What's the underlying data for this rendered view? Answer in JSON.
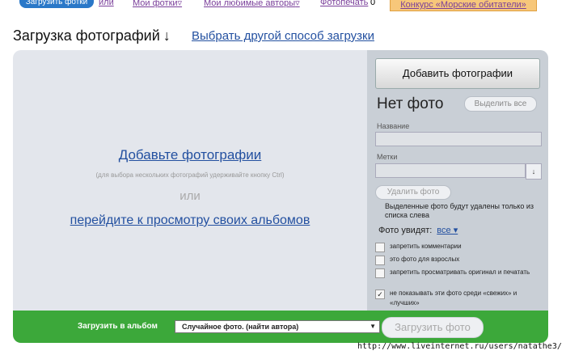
{
  "topnav": {
    "upload_tab": "Загрузить фотки",
    "or": "или",
    "my_photos": "Мои фотки",
    "favorite_authors": "Мои любимые авторы",
    "photo_print": "Фотопечать",
    "photo_print_count": "0",
    "contest": "Конкурс «Морские обитатели»",
    "dropdown_glyph": "▿"
  },
  "header": {
    "title": "Загрузка фотографий",
    "title_arrow": "↓",
    "alt_method_link": "Выбрать другой способ загрузки"
  },
  "dropzone": {
    "add_link": "Добавьте фотографии",
    "hint": "(для выбора нескольких фотографий удерживайте кнопку Ctrl)",
    "or": "или",
    "albums_link": "перейдите к просмотру своих альбомов"
  },
  "sidebar": {
    "add_button": "Добавить фотографии",
    "no_photo": "Нет фото",
    "select_all": "Выделить все",
    "name_label": "Название",
    "name_value": "",
    "tags_label": "Метки",
    "tags_value": "",
    "tags_dropdown_glyph": "↓",
    "delete_button": "Удалить фото",
    "delete_note": "Выделенные фото будут удалены только из списка слева",
    "visibility_label": "Фото увидят:",
    "visibility_value": "все ▾",
    "options": [
      {
        "label": "запретить комментарии",
        "checked": false
      },
      {
        "label": "это фото для взрослых",
        "checked": false
      },
      {
        "label": "запретить просматривать оригинал и печатать",
        "checked": false
      },
      {
        "label": "не показывать эти фото среди «свежих» и «лучших»",
        "checked": true
      }
    ],
    "check_glyph": "✓"
  },
  "bottom_bar": {
    "album_label": "Загрузить в альбом",
    "album_select": "Случайное фото. (найти автора)",
    "select_caret": "▼",
    "upload_button": "Загрузить фото"
  },
  "footer": {
    "url": "http://www.liveinternet.ru/users/natathe3/"
  },
  "colors": {
    "accent_blue": "#2a78c8",
    "link": "#2350a0",
    "bottom_bar": "#3ca83a",
    "panel": "#e3e6ec",
    "sidebar": "#c9cfd6"
  }
}
